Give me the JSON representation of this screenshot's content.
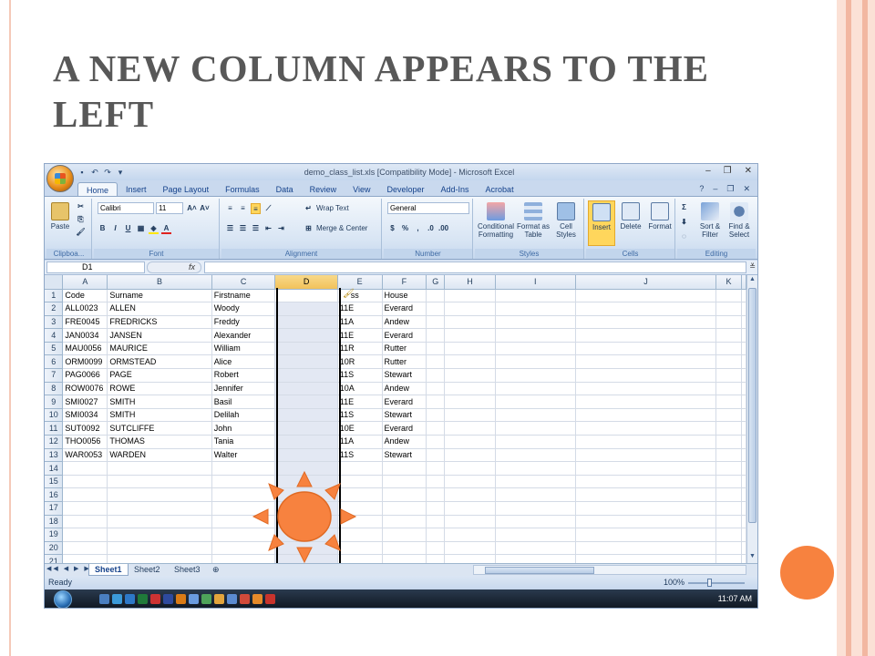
{
  "slide": {
    "title": "A NEW COLUMN APPEARS TO THE LEFT"
  },
  "excel": {
    "window_title": "demo_class_list.xls [Compatibility Mode] - Microsoft Excel",
    "ribbon_tabs": [
      "Home",
      "Insert",
      "Page Layout",
      "Formulas",
      "Data",
      "Review",
      "View",
      "Developer",
      "Add-Ins",
      "Acrobat"
    ],
    "active_tab": "Home",
    "clipboard": {
      "paste": "Paste",
      "label": "Clipboa..."
    },
    "font": {
      "name": "Calibri",
      "size": "11",
      "label": "Font"
    },
    "alignment": {
      "wrap_text": "Wrap Text",
      "merge_center": "Merge & Center",
      "label": "Alignment"
    },
    "number": {
      "format": "General",
      "label": "Number"
    },
    "styles": {
      "conditional": "Conditional Formatting",
      "format_table": "Format as Table",
      "cell_styles": "Cell Styles",
      "label": "Styles"
    },
    "cells": {
      "insert": "Insert",
      "delete": "Delete",
      "format": "Format",
      "label": "Cells"
    },
    "editing": {
      "sort_filter": "Sort & Filter",
      "find_select": "Find & Select",
      "label": "Editing"
    },
    "name_box": "D1",
    "fx": "fx",
    "columns": [
      "A",
      "B",
      "C",
      "D",
      "E",
      "F",
      "G",
      "H",
      "I",
      "J",
      "K"
    ],
    "selected_column": "D",
    "rows": [
      [
        "Code",
        "Surname",
        "Firstname",
        "",
        "ss",
        "House"
      ],
      [
        "ALL0023",
        "ALLEN",
        "Woody",
        "",
        "11E",
        "Everard"
      ],
      [
        "FRE0045",
        "FREDRICKS",
        "Freddy",
        "",
        "11A",
        "Andew"
      ],
      [
        "JAN0034",
        "JANSEN",
        "Alexander",
        "",
        "11E",
        "Everard"
      ],
      [
        "MAU0056",
        "MAURICE",
        "William",
        "",
        "11R",
        "Rutter"
      ],
      [
        "ORM0099",
        "ORMSTEAD",
        "Alice",
        "",
        "10R",
        "Rutter"
      ],
      [
        "PAG0066",
        "PAGE",
        "Robert",
        "",
        "11S",
        "Stewart"
      ],
      [
        "ROW0076",
        "ROWE",
        "Jennifer",
        "",
        "10A",
        "Andew"
      ],
      [
        "SMI0027",
        "SMITH",
        "Basil",
        "",
        "11E",
        "Everard"
      ],
      [
        "SMI0034",
        "SMITH",
        "Delilah",
        "",
        "11S",
        "Stewart"
      ],
      [
        "SUT0092",
        "SUTCLIFFE",
        "John",
        "",
        "10E",
        "Everard"
      ],
      [
        "THO0056",
        "THOMAS",
        "Tania",
        "",
        "11A",
        "Andew"
      ],
      [
        "WAR0053",
        "WARDEN",
        "Walter",
        "",
        "11S",
        "Stewart"
      ],
      [
        "",
        "",
        "",
        "",
        "",
        ""
      ],
      [
        "",
        "",
        "",
        "",
        "",
        ""
      ],
      [
        "",
        "",
        "",
        "",
        "",
        ""
      ],
      [
        "",
        "",
        "",
        "",
        "",
        ""
      ],
      [
        "",
        "",
        "",
        "",
        "",
        ""
      ],
      [
        "",
        "",
        "",
        "",
        "",
        ""
      ],
      [
        "",
        "",
        "",
        "",
        "",
        ""
      ],
      [
        "",
        "",
        "",
        "",
        "",
        ""
      ]
    ],
    "row_numbers": [
      "1",
      "2",
      "3",
      "4",
      "5",
      "6",
      "7",
      "8",
      "9",
      "10",
      "11",
      "12",
      "13",
      "14",
      "15",
      "16",
      "17",
      "18",
      "19",
      "20",
      "21"
    ],
    "sheet_tabs": [
      "Sheet1",
      "Sheet2",
      "Sheet3"
    ],
    "active_sheet": "Sheet1",
    "status": "Ready",
    "zoom": "100%",
    "clock": "11:07 AM"
  },
  "colors": {
    "accent": "#f7823f",
    "sun_fill": "#f7823f",
    "sun_stroke": "#e06a24"
  }
}
